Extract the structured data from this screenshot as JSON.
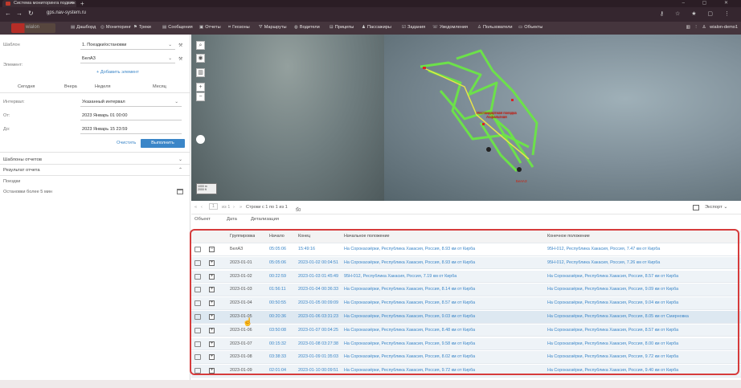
{
  "browser": {
    "tab_title": "Система мониторинга подвиж",
    "url": "gps.nav-system.ru",
    "new_tab": "+",
    "tab_close": "×"
  },
  "menu": {
    "logo": "wialon",
    "items": [
      "Дашборд",
      "Мониторинг",
      "Треки",
      "Сообщения",
      "Отчеты",
      "Геозоны",
      "Маршруты",
      "Водители",
      "Прицепы",
      "Пассажиры",
      "Задания",
      "Уведомления",
      "Пользователи",
      "Объекты"
    ],
    "user": "wialon-demo1"
  },
  "panel": {
    "template_label": "Шаблон",
    "template_value": "1. Поездки/остановки",
    "element_label": "Элемент:",
    "element_value": "БелАЗ",
    "add_element": "Добавить элемент",
    "periods": [
      "Сегодня",
      "Вчера",
      "Неделя",
      "Месяц"
    ],
    "interval_label": "Интервал:",
    "interval_value": "Указанный интервал",
    "from_label": "От:",
    "from_value": "2023 Январь 01 00:00",
    "to_label": "До:",
    "to_value": "2023 Январь 15 23:59",
    "clear": "Очистить",
    "execute": "Выполнить",
    "templates_section": "Шаблоны отчетов",
    "result_section": "Результат отчета",
    "result_items": [
      "Поездки",
      "Остановки более 5 мин"
    ]
  },
  "map": {
    "scale_label": "1000 m",
    "scale_label2": "2000 ft",
    "unit_label": "Нестандартная поездка",
    "unit_label2": "Асфальтная",
    "unit_name": "БелАЗ"
  },
  "pager": {
    "page": "1",
    "of": "из 1",
    "rows": "Строки с 1 по 1 из 1",
    "per_page": "50",
    "export": "Экспорт"
  },
  "tabs": [
    "Объект",
    "Дата",
    "Детализация"
  ],
  "table": {
    "headers": [
      "Группировка",
      "Начало",
      "Конец",
      "Начальное положение",
      "Конечное положение"
    ],
    "rows": [
      {
        "group": "БелАЗ",
        "start": "05:05:06",
        "end": "15:49:16",
        "from": "На Сорокаозёрки, Республика Хакасия, Россия, 8.93 км от Кирба",
        "to": "95Н-012, Республика Хакасия, Россия, 7.47 км от Кирба",
        "kind": "first"
      },
      {
        "group": "2023-01-01",
        "start": "05:05:06",
        "end": "2023-01-02 00:04:51",
        "from": "На Сорокаозёрки, Республика Хакасия, Россия, 8.93 км от Кирба",
        "to": "95Н-012, Республика Хакасия, Россия, 7.26 км от Кирба",
        "kind": "day"
      },
      {
        "group": "2023-01-02",
        "start": "00:22:59",
        "end": "2023-01-03 01:45:49",
        "from": "95Н-012, Республика Хакасия, Россия, 7.19 км от Кирба",
        "to": "На Сорокаозёрки, Республика Хакасия, Россия, 8.57 км от Кирба",
        "kind": "day"
      },
      {
        "group": "2023-01-03",
        "start": "01:56:11",
        "end": "2023-01-04 00:36:33",
        "from": "На Сорокаозёрки, Республика Хакасия, Россия, 8.14 км от Кирба",
        "to": "На Сорокаозёрки, Республика Хакасия, Россия, 9.09 км от Кирба",
        "kind": "day"
      },
      {
        "group": "2023-01-04",
        "start": "00:50:55",
        "end": "2023-01-05 00:09:09",
        "from": "На Сорокаозёрки, Республика Хакасия, Россия, 8.57 км от Кирба",
        "to": "На Сорокаозёрки, Республика Хакасия, Россия, 9.04 км от Кирба",
        "kind": "day"
      },
      {
        "group": "2023-01-05",
        "start": "00:20:36",
        "end": "2023-01-06 03:31:23",
        "from": "На Сорокаозёрки, Республика Хакасия, Россия, 9.03 км от Кирба",
        "to": "На Сорокаозёрки, Республика Хакасия, Россия, 8.05 км от Смирновка",
        "kind": "sel"
      },
      {
        "group": "2023-01-06",
        "start": "03:50:08",
        "end": "2023-01-07 00:04:25",
        "from": "На Сорокаозёрки, Республика Хакасия, Россия, 8.48 км от Кирба",
        "to": "На Сорокаозёрки, Республика Хакасия, Россия, 8.57 км от Кирба",
        "kind": "day"
      },
      {
        "group": "2023-01-07",
        "start": "00:15:32",
        "end": "2023-01-08 03:27:38",
        "from": "На Сорокаозёрки, Республика Хакасия, Россия, 9.58 км от Кирба",
        "to": "На Сорокаозёрки, Республика Хакасия, Россия, 8.00 км от Кирба",
        "kind": "day"
      },
      {
        "group": "2023-01-08",
        "start": "03:38:33",
        "end": "2023-01-09 01:35:03",
        "from": "На Сорокаозёрки, Республика Хакасия, Россия, 8.02 км от Кирба",
        "to": "На Сорокаозёрки, Республика Хакасия, Россия, 9.72 км от Кирба",
        "kind": "day"
      },
      {
        "group": "2023-01-09",
        "start": "02:01:04",
        "end": "2023-01-10 00:09:51",
        "from": "На Сорокаозёрки, Республика Хакасия, Россия, 9.72 км от Кирба",
        "to": "На Сорокаозёрки, Республика Хакасия, Россия, 9.40 км от Кирба",
        "kind": "day"
      }
    ]
  }
}
